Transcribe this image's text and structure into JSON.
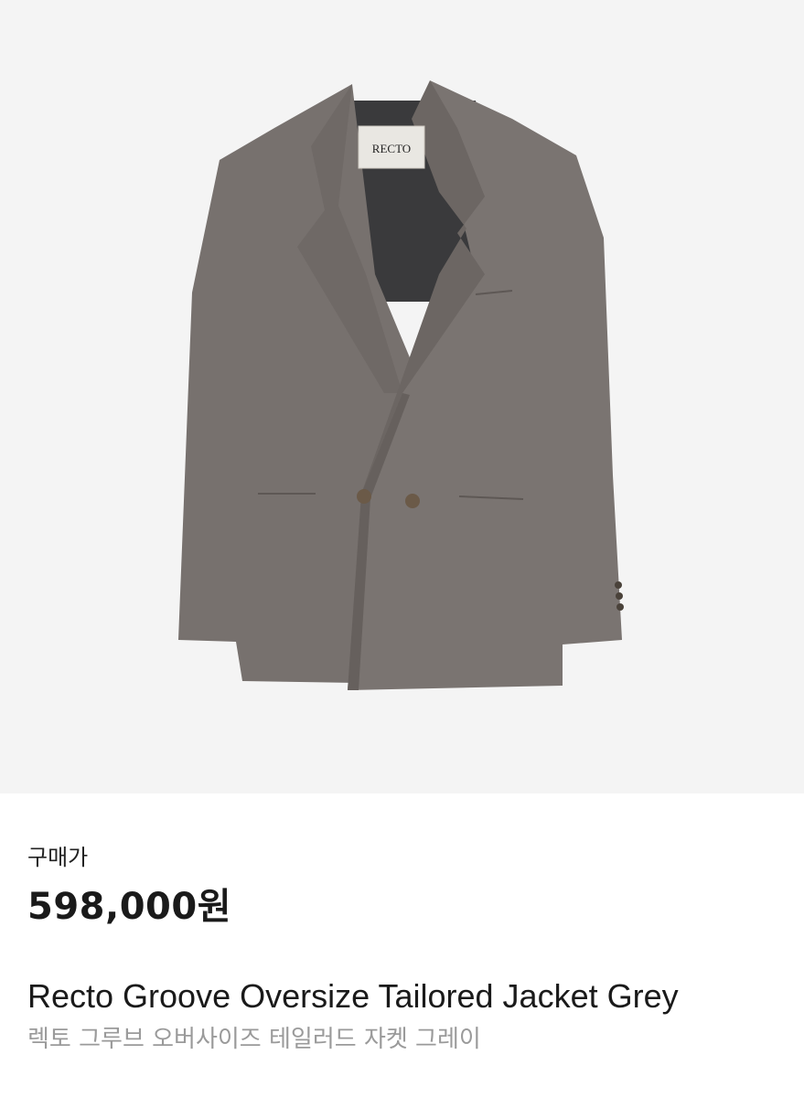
{
  "product": {
    "image_alt": "jacket-photo",
    "label_text": "RECTO",
    "price_caption": "구매가",
    "price": "598,000원",
    "name_en": "Recto Groove Oversize Tailored Jacket Grey",
    "name_ko": "렉토 그루브 오버사이즈 테일러드 자켓 그레이"
  },
  "colors": {
    "image_bg": "#f4f4f4",
    "jacket": "#77716e",
    "lining": "#3a3a3c",
    "subtext": "#9a9a9a"
  }
}
